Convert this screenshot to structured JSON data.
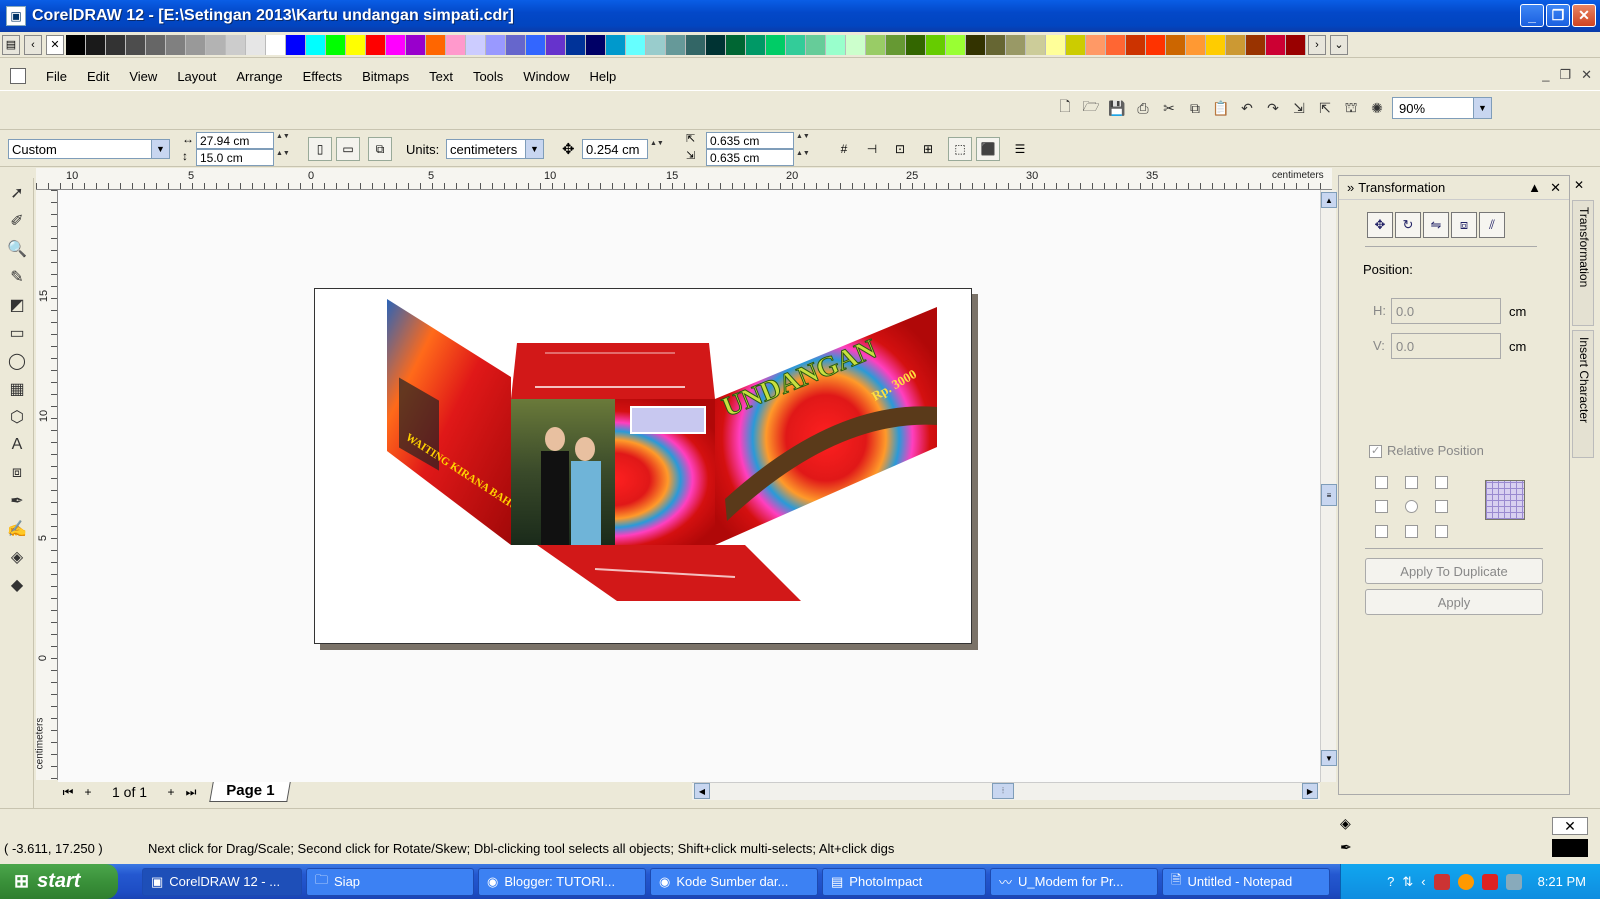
{
  "window": {
    "title": "CorelDRAW 12 - [E:\\Setingan 2013\\Kartu undangan simpati.cdr]"
  },
  "palette": [
    "#000000",
    "#1a1a1a",
    "#333333",
    "#4d4d4d",
    "#666666",
    "#808080",
    "#999999",
    "#b3b3b3",
    "#cccccc",
    "#e6e6e6",
    "#ffffff",
    "#0000ff",
    "#00ffff",
    "#00ff00",
    "#ffff00",
    "#ff0000",
    "#ff00ff",
    "#9900cc",
    "#ff6600",
    "#ff99cc",
    "#ccccff",
    "#9999ff",
    "#6666cc",
    "#3366ff",
    "#6633cc",
    "#003399",
    "#000066",
    "#0099cc",
    "#66ffff",
    "#99cccc",
    "#669999",
    "#336666",
    "#003333",
    "#006633",
    "#009966",
    "#00cc66",
    "#33cc99",
    "#66cc99",
    "#99ffcc",
    "#ccffcc",
    "#99cc66",
    "#669933",
    "#336600",
    "#66cc00",
    "#99ff33",
    "#333300",
    "#666633",
    "#999966",
    "#cccc99",
    "#ffff99",
    "#cccc00",
    "#ff9966",
    "#ff6633",
    "#cc3300",
    "#ff3300",
    "#cc6600",
    "#ff9933",
    "#ffcc00",
    "#cc9933",
    "#993300",
    "#cc0033",
    "#990000"
  ],
  "menu": [
    "File",
    "Edit",
    "View",
    "Layout",
    "Arrange",
    "Effects",
    "Bitmaps",
    "Text",
    "Tools",
    "Window",
    "Help"
  ],
  "toolbar": {
    "zoom": "90%"
  },
  "propbar": {
    "paper": "Custom",
    "width": "27.94 cm",
    "height": "15.0 cm",
    "units_label": "Units:",
    "units": "centimeters",
    "nudge": "0.254 cm",
    "dup_x": "0.635 cm",
    "dup_y": "0.635 cm"
  },
  "ruler": {
    "h_ticks": [
      "10",
      "5",
      "0",
      "5",
      "10",
      "15",
      "20",
      "25",
      "30",
      "35"
    ],
    "h_unit": "centimeters",
    "v_ticks": [
      "15",
      "10",
      "5",
      "0"
    ],
    "v_unit": "centimeters"
  },
  "artwork": {
    "banner": "UNDANGAN",
    "price": "Rp. 3000",
    "side_text": "WAITING KIRANA BAHUR"
  },
  "pagenav": {
    "count": "1 of 1",
    "tab": "Page 1"
  },
  "docker": {
    "title": "Transformation",
    "position_label": "Position:",
    "h_label": "H:",
    "h_value": "0.0",
    "v_label": "V:",
    "v_value": "0.0",
    "unit": "cm",
    "relative": "Relative Position",
    "apply_dup": "Apply To Duplicate",
    "apply": "Apply"
  },
  "sidetabs": [
    "Transformation",
    "Insert Character"
  ],
  "status": {
    "coords": "( -3.611, 17.250 )",
    "hint": "Next click for Drag/Scale; Second click for Rotate/Skew; Dbl-clicking tool selects all objects; Shift+click multi-selects; Alt+click digs"
  },
  "taskbar": {
    "start": "start",
    "tasks": [
      "CorelDRAW 12 - ...",
      "Siap",
      "Blogger: TUTORI...",
      "Kode Sumber dar...",
      "PhotoImpact",
      "U_Modem for Pr...",
      "Untitled - Notepad"
    ],
    "clock": "8:21 PM"
  }
}
